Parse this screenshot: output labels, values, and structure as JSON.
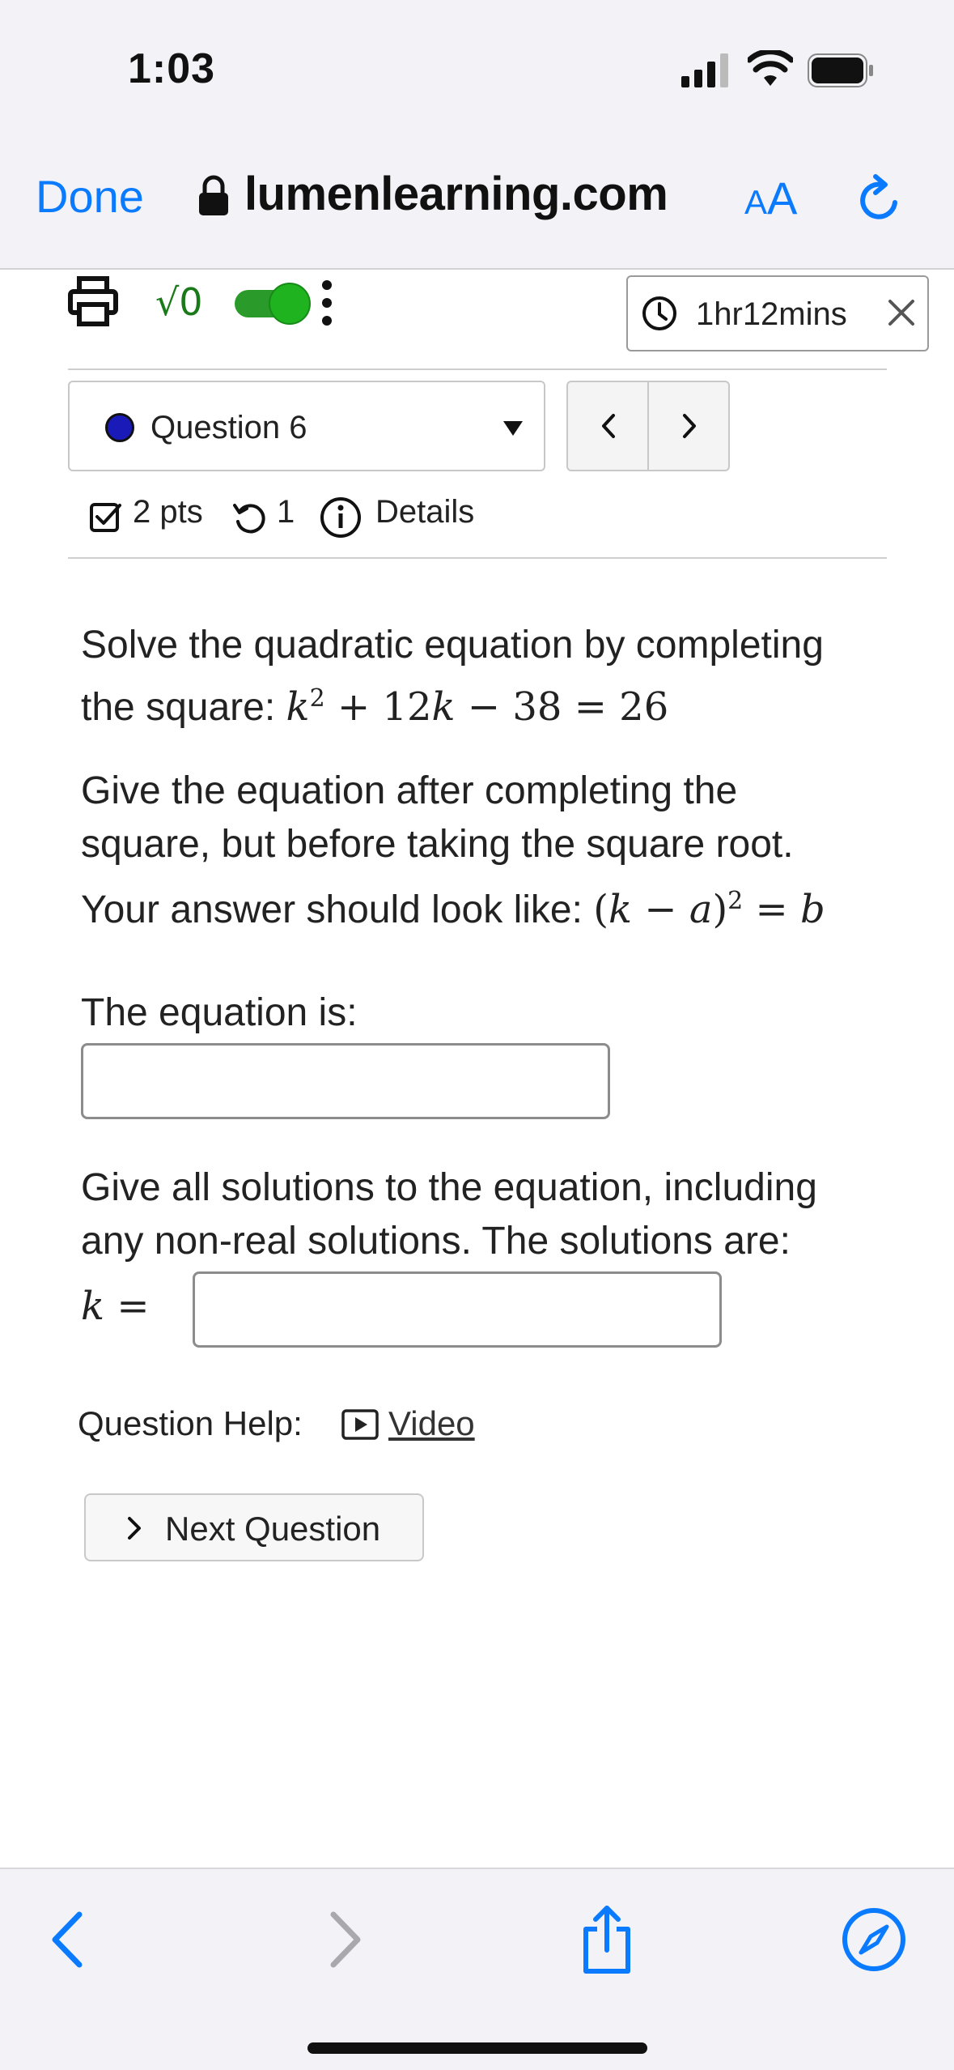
{
  "status_bar": {
    "time": "1:03"
  },
  "browser": {
    "done_label": "Done",
    "url": "lumenlearning.com",
    "aa_label_small": "A",
    "aa_label_large": "A"
  },
  "toolbar": {
    "sqrt_label": "√0",
    "timer": "1hr12mins"
  },
  "question_nav": {
    "current": "Question 6",
    "prev": "<",
    "next": ">"
  },
  "meta": {
    "points": "2 pts",
    "attempts": "1",
    "details": "Details"
  },
  "question": {
    "intro_line1": "Solve the quadratic equation by completing",
    "intro_line2_prefix": "the square:",
    "instruction_line1": "Give the equation after completing the",
    "instruction_line2": "square, but before taking the square root.",
    "instruction_line3_prefix": "Your answer should look like:",
    "equation_prompt": "The equation is:",
    "equation_value": "",
    "solutions_line1": "Give all solutions to the equation, including",
    "solutions_line2": "any non-real solutions. The solutions are:",
    "k_value": ""
  },
  "help": {
    "label": "Question Help:",
    "video": "Video"
  },
  "next_question": "Next Question",
  "colors": {
    "ios_blue": "#0a7aff",
    "toggle_green": "#1fb31f",
    "question_dot": "#1a1ab8"
  }
}
